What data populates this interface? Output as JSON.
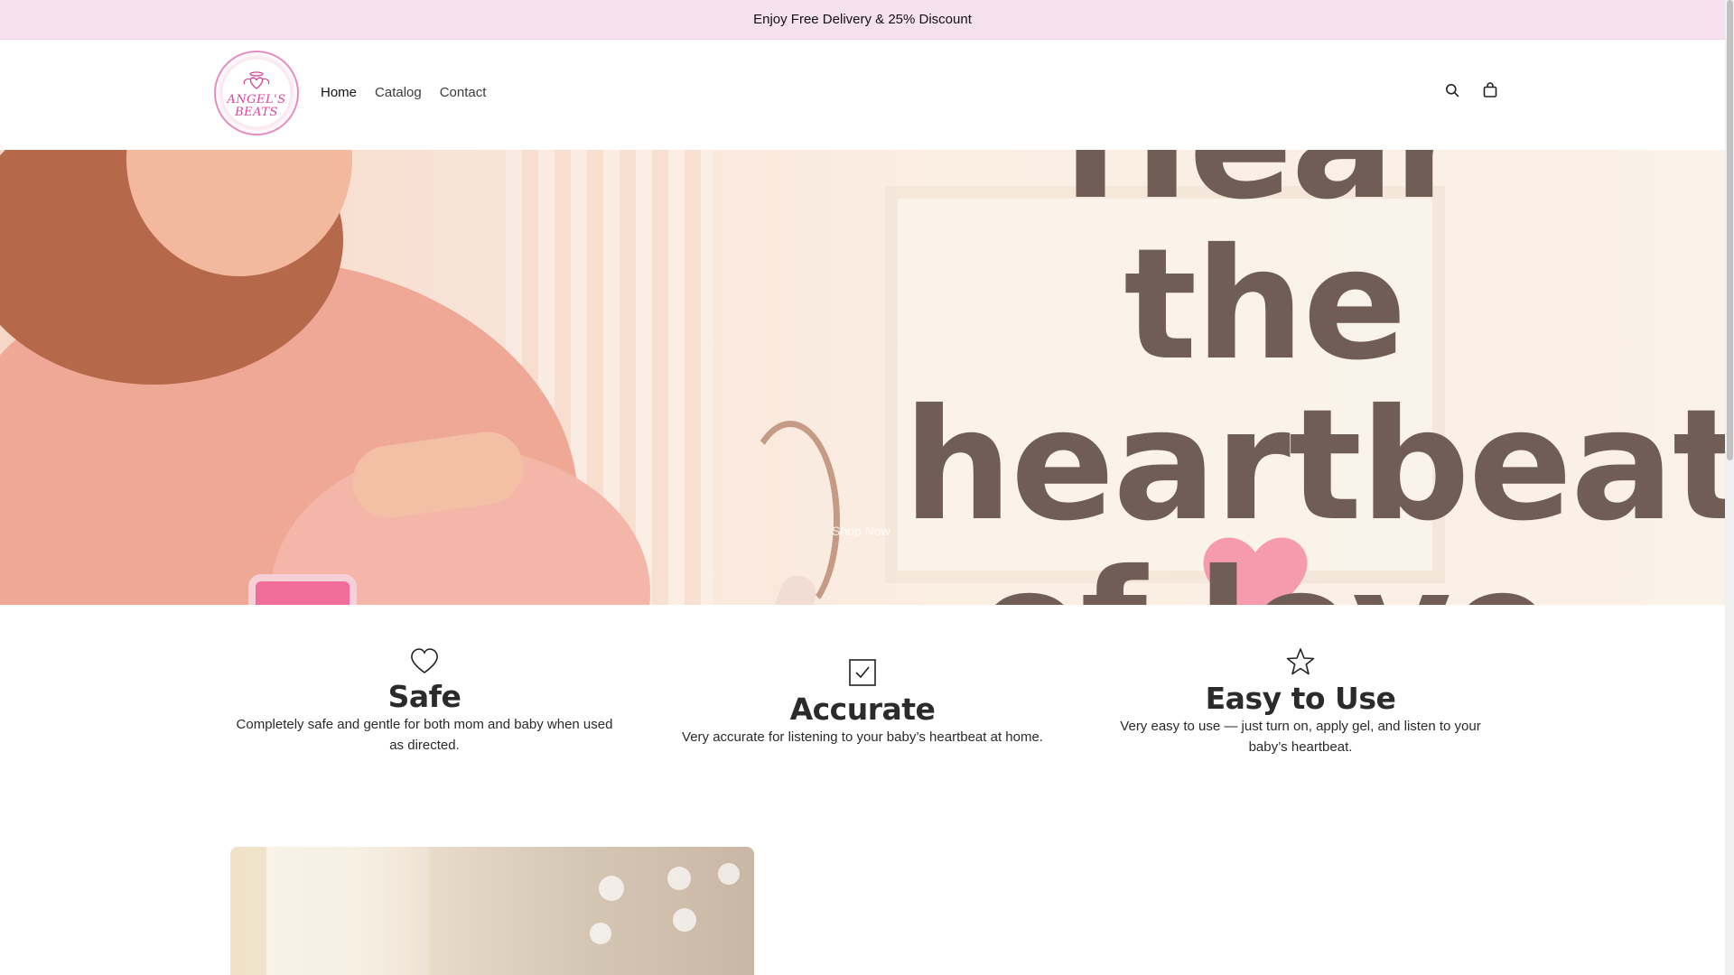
{
  "announcement": {
    "text": "Enjoy Free Delivery & 25% Discount"
  },
  "header": {
    "logo": {
      "text": "ANGEL'S BEATS"
    },
    "nav": [
      {
        "label": "Home"
      },
      {
        "label": "Catalog"
      },
      {
        "label": "Contact"
      }
    ],
    "icons": {
      "search": "search-icon",
      "cart": "shopping-bag-icon"
    }
  },
  "hero": {
    "headline_lines": [
      "Hear the",
      "heartbeat",
      "of love"
    ],
    "cta_label": "Shop Now"
  },
  "features": [
    {
      "icon": "heart-icon",
      "title": "Safe",
      "description": "Completely safe and gentle for both mom and baby when used as directed."
    },
    {
      "icon": "checkbox-icon",
      "title": "Accurate",
      "description": "Very accurate for listening to your baby’s heartbeat at home."
    },
    {
      "icon": "star-icon",
      "title": "Easy to Use",
      "description": "Very easy to use — just turn on, apply gel, and listen to your baby’s heartbeat."
    }
  ],
  "colors": {
    "announcement_bg": "#f5e1ef",
    "hero_text": "#6f5d56",
    "brand_pink": "#d6479a"
  }
}
